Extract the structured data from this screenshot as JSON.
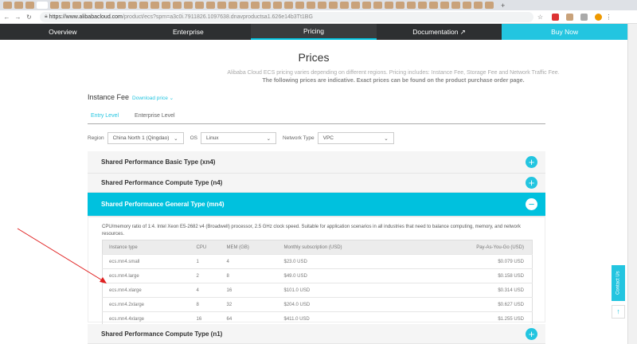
{
  "browser": {
    "url_host": "https://www.alibabacloud.com",
    "url_path": "/product/ecs?spm=a3c0i.7911826.1097638.dnavproductsa1.626e14b3Tt1BG"
  },
  "nav": {
    "items": [
      "Overview",
      "Enterprise",
      "Pricing",
      "Documentation ↗",
      "Buy Now"
    ]
  },
  "page": {
    "title": "Prices",
    "subtitle": "Alibaba Cloud ECS pricing varies depending on different regions. Pricing includes: Instance Fee, Storage Fee and Network Traffic Fee.",
    "note": "The following prices are indicative. Exact prices can be found on the product purchase order page.",
    "instance_fee": "Instance Fee",
    "download": "Download price ⌄"
  },
  "level_tabs": [
    "Entry Level",
    "Enterprise Level"
  ],
  "filters": {
    "region_label": "Region",
    "region": "China North 1 (Qingdao)",
    "os_label": "OS",
    "os": "Linux",
    "net_label": "Network Type",
    "net": "VPC"
  },
  "sections": [
    "Shared Performance Basic Type (xn4)",
    "Shared Performance Compute Type (n4)",
    "Shared Performance General Type (mn4)",
    "Shared Performance Compute Type (n1)"
  ],
  "desc": "CPU/memory ratio of 1:4. Intel Xeon E5-2682 v4 (Broadwell) processor, 2.5 GHz clock speed. Suitable for application scenarios in all industries that need to balance computing, memory, and network resources.",
  "table": {
    "headers": [
      "Instance type",
      "CPU",
      "MEM (GB)",
      "Monthly subscription (USD)",
      "Pay-As-You-Go (USD)"
    ],
    "rows": [
      [
        "ecs.mn4.small",
        "1",
        "4",
        "$23.0 USD",
        "$0.079 USD"
      ],
      [
        "ecs.mn4.large",
        "2",
        "8",
        "$49.0 USD",
        "$0.158 USD"
      ],
      [
        "ecs.mn4.xlarge",
        "4",
        "16",
        "$101.0 USD",
        "$0.314 USD"
      ],
      [
        "ecs.mn4.2xlarge",
        "8",
        "32",
        "$204.0 USD",
        "$0.627 USD"
      ],
      [
        "ecs.mn4.4xlarge",
        "16",
        "64",
        "$411.0 USD",
        "$1.255 USD"
      ]
    ]
  },
  "contact": "Contact Us",
  "colors": {
    "accent": "#23c5e0",
    "annotation": "#e02020"
  }
}
